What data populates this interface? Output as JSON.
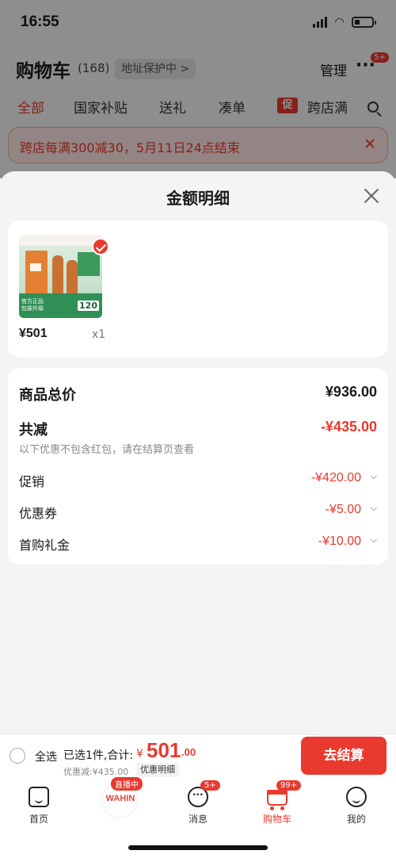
{
  "status_bar": {
    "time": "16:55"
  },
  "background": {
    "cart_title": "购物车",
    "cart_count": "(168)",
    "address": "地址保护中 >",
    "manage": "管理",
    "more_badge": "5+",
    "tabs": [
      "全部",
      "国家补贴",
      "送礼",
      "凑单",
      "跨店满"
    ],
    "promo_tag": "促",
    "banner": "跨店每满300减30，5月11日24点结束"
  },
  "sheet": {
    "title": "金额明细",
    "product": {
      "price": "¥501",
      "qty": "x1",
      "image_strip_text": "官方正品 包装升级",
      "image_strip_num": "120"
    },
    "total": {
      "label": "商品总价",
      "value": "¥936.00"
    },
    "reduction": {
      "label": "共减",
      "value": "-¥435.00",
      "note": "以下优惠不包含红包，请在结算页查看"
    },
    "items": [
      {
        "label": "促销",
        "value": "-¥420.00"
      },
      {
        "label": "优惠券",
        "value": "-¥5.00"
      },
      {
        "label": "首购礼金",
        "value": "-¥10.00"
      }
    ]
  },
  "checkout": {
    "select_all": "全选",
    "selected": "已选1件,合计:",
    "currency": "¥",
    "total_int": "501",
    "total_dec": ".00",
    "discount": "优惠减:¥435.00",
    "discount_detail": "优惠明细",
    "pay": "去结算"
  },
  "tabbar": {
    "home": "首页",
    "live_badge": "直播中",
    "live_logo": "WAHIN",
    "messages": "消息",
    "messages_badge": "5+",
    "cart": "购物车",
    "cart_badge": "99+",
    "me": "我的"
  }
}
